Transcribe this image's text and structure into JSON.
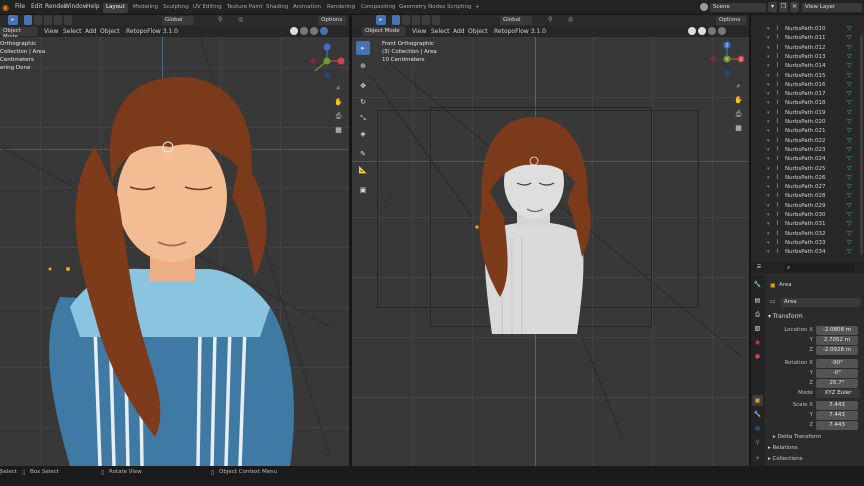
{
  "topbar": {
    "menus": [
      "File",
      "Edit",
      "Render",
      "Window",
      "Help"
    ],
    "workspaces": [
      "Layout",
      "Modeling",
      "Sculpting",
      "UV Editing",
      "Texture Paint",
      "Shading",
      "Animation",
      "Rendering",
      "Compositing",
      "Geometry Nodes",
      "Scripting"
    ],
    "active_workspace": "Layout",
    "add_workspace": "+",
    "scene": "Scene",
    "view_layer": "View Layer"
  },
  "left_viewport": {
    "mode": "Object Mode",
    "menus": [
      "View",
      "Select",
      "Add",
      "Object",
      "RetopoFlow 3.1.0"
    ],
    "transform_orientation": "Global",
    "options": "Options",
    "overlay_lines": [
      "Orthographic",
      "Collection | Area",
      "Centimeters",
      "ering Done"
    ]
  },
  "right_viewport": {
    "mode": "Object Mode",
    "menus": [
      "View",
      "Select",
      "Add",
      "Object",
      "RetopoFlow 3.1.0"
    ],
    "transform_orientation": "Global",
    "options": "Options",
    "overlay_lines": [
      "Front Orthographic",
      "(3) Collection | Area",
      "10 Centimeters"
    ],
    "gizmo_labels": {
      "z": "Z",
      "y": "Y",
      "x": "X"
    }
  },
  "outliner": {
    "items": [
      "NurbsPath.010",
      "NurbsPath.011",
      "NurbsPath.012",
      "NurbsPath.013",
      "NurbsPath.014",
      "NurbsPath.015",
      "NurbsPath.016",
      "NurbsPath.017",
      "NurbsPath.018",
      "NurbsPath.019",
      "NurbsPath.020",
      "NurbsPath.021",
      "NurbsPath.022",
      "NurbsPath.023",
      "NurbsPath.024",
      "NurbsPath.025",
      "NurbsPath.026",
      "NurbsPath.027",
      "NurbsPath.028",
      "NurbsPath.029",
      "NurbsPath.030",
      "NurbsPath.031",
      "NurbsPath.032",
      "NurbsPath.033",
      "NurbsPath.034"
    ]
  },
  "properties": {
    "object_name": "Area",
    "data_name": "Area",
    "transform_header": "Transform",
    "location_label": "Location X",
    "location": [
      "-2.0808 m",
      "2.7052 m",
      "-2.0928 m"
    ],
    "rotation_label": "Rotation X",
    "rotation": [
      "-90°",
      "-0°",
      "25.7°"
    ],
    "mode_label": "Mode",
    "mode": "XYZ Euler",
    "scale_label": "Scale X",
    "scale": [
      "7.443",
      "7.443",
      "7.443"
    ],
    "axis_y": "Y",
    "axis_z": "Z",
    "delta_transform": "Delta Transform",
    "relations": "Relations",
    "collections": "Collections"
  },
  "statusbar": {
    "items": [
      "Select",
      "Box Select",
      "Rotate View",
      "Object Context Menu"
    ]
  },
  "colors": {
    "accent": "#4772b3",
    "workspace_active": "#3d3d3d",
    "red_axis": "#c8464d",
    "green_axis": "#6a9c2e",
    "blue_axis": "#3d6fc9",
    "hair": "#7b3a1a",
    "skin": "#f1b98e",
    "dress_blue": "#3c78a0"
  }
}
